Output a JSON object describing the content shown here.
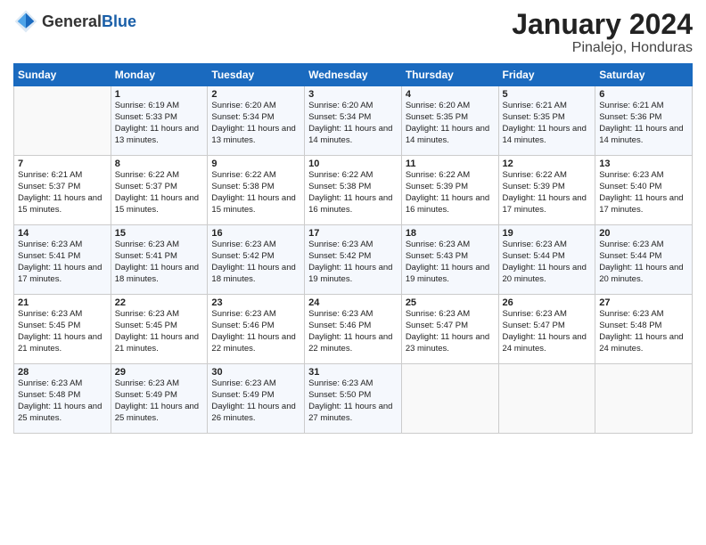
{
  "logo": {
    "text_general": "General",
    "text_blue": "Blue"
  },
  "title": "January 2024",
  "subtitle": "Pinalejo, Honduras",
  "days_header": [
    "Sunday",
    "Monday",
    "Tuesday",
    "Wednesday",
    "Thursday",
    "Friday",
    "Saturday"
  ],
  "weeks": [
    [
      {
        "day": "",
        "sunrise": "",
        "sunset": "",
        "daylight": ""
      },
      {
        "day": "1",
        "sunrise": "Sunrise: 6:19 AM",
        "sunset": "Sunset: 5:33 PM",
        "daylight": "Daylight: 11 hours and 13 minutes."
      },
      {
        "day": "2",
        "sunrise": "Sunrise: 6:20 AM",
        "sunset": "Sunset: 5:34 PM",
        "daylight": "Daylight: 11 hours and 13 minutes."
      },
      {
        "day": "3",
        "sunrise": "Sunrise: 6:20 AM",
        "sunset": "Sunset: 5:34 PM",
        "daylight": "Daylight: 11 hours and 14 minutes."
      },
      {
        "day": "4",
        "sunrise": "Sunrise: 6:20 AM",
        "sunset": "Sunset: 5:35 PM",
        "daylight": "Daylight: 11 hours and 14 minutes."
      },
      {
        "day": "5",
        "sunrise": "Sunrise: 6:21 AM",
        "sunset": "Sunset: 5:35 PM",
        "daylight": "Daylight: 11 hours and 14 minutes."
      },
      {
        "day": "6",
        "sunrise": "Sunrise: 6:21 AM",
        "sunset": "Sunset: 5:36 PM",
        "daylight": "Daylight: 11 hours and 14 minutes."
      }
    ],
    [
      {
        "day": "7",
        "sunrise": "Sunrise: 6:21 AM",
        "sunset": "Sunset: 5:37 PM",
        "daylight": "Daylight: 11 hours and 15 minutes."
      },
      {
        "day": "8",
        "sunrise": "Sunrise: 6:22 AM",
        "sunset": "Sunset: 5:37 PM",
        "daylight": "Daylight: 11 hours and 15 minutes."
      },
      {
        "day": "9",
        "sunrise": "Sunrise: 6:22 AM",
        "sunset": "Sunset: 5:38 PM",
        "daylight": "Daylight: 11 hours and 15 minutes."
      },
      {
        "day": "10",
        "sunrise": "Sunrise: 6:22 AM",
        "sunset": "Sunset: 5:38 PM",
        "daylight": "Daylight: 11 hours and 16 minutes."
      },
      {
        "day": "11",
        "sunrise": "Sunrise: 6:22 AM",
        "sunset": "Sunset: 5:39 PM",
        "daylight": "Daylight: 11 hours and 16 minutes."
      },
      {
        "day": "12",
        "sunrise": "Sunrise: 6:22 AM",
        "sunset": "Sunset: 5:39 PM",
        "daylight": "Daylight: 11 hours and 17 minutes."
      },
      {
        "day": "13",
        "sunrise": "Sunrise: 6:23 AM",
        "sunset": "Sunset: 5:40 PM",
        "daylight": "Daylight: 11 hours and 17 minutes."
      }
    ],
    [
      {
        "day": "14",
        "sunrise": "Sunrise: 6:23 AM",
        "sunset": "Sunset: 5:41 PM",
        "daylight": "Daylight: 11 hours and 17 minutes."
      },
      {
        "day": "15",
        "sunrise": "Sunrise: 6:23 AM",
        "sunset": "Sunset: 5:41 PM",
        "daylight": "Daylight: 11 hours and 18 minutes."
      },
      {
        "day": "16",
        "sunrise": "Sunrise: 6:23 AM",
        "sunset": "Sunset: 5:42 PM",
        "daylight": "Daylight: 11 hours and 18 minutes."
      },
      {
        "day": "17",
        "sunrise": "Sunrise: 6:23 AM",
        "sunset": "Sunset: 5:42 PM",
        "daylight": "Daylight: 11 hours and 19 minutes."
      },
      {
        "day": "18",
        "sunrise": "Sunrise: 6:23 AM",
        "sunset": "Sunset: 5:43 PM",
        "daylight": "Daylight: 11 hours and 19 minutes."
      },
      {
        "day": "19",
        "sunrise": "Sunrise: 6:23 AM",
        "sunset": "Sunset: 5:44 PM",
        "daylight": "Daylight: 11 hours and 20 minutes."
      },
      {
        "day": "20",
        "sunrise": "Sunrise: 6:23 AM",
        "sunset": "Sunset: 5:44 PM",
        "daylight": "Daylight: 11 hours and 20 minutes."
      }
    ],
    [
      {
        "day": "21",
        "sunrise": "Sunrise: 6:23 AM",
        "sunset": "Sunset: 5:45 PM",
        "daylight": "Daylight: 11 hours and 21 minutes."
      },
      {
        "day": "22",
        "sunrise": "Sunrise: 6:23 AM",
        "sunset": "Sunset: 5:45 PM",
        "daylight": "Daylight: 11 hours and 21 minutes."
      },
      {
        "day": "23",
        "sunrise": "Sunrise: 6:23 AM",
        "sunset": "Sunset: 5:46 PM",
        "daylight": "Daylight: 11 hours and 22 minutes."
      },
      {
        "day": "24",
        "sunrise": "Sunrise: 6:23 AM",
        "sunset": "Sunset: 5:46 PM",
        "daylight": "Daylight: 11 hours and 22 minutes."
      },
      {
        "day": "25",
        "sunrise": "Sunrise: 6:23 AM",
        "sunset": "Sunset: 5:47 PM",
        "daylight": "Daylight: 11 hours and 23 minutes."
      },
      {
        "day": "26",
        "sunrise": "Sunrise: 6:23 AM",
        "sunset": "Sunset: 5:47 PM",
        "daylight": "Daylight: 11 hours and 24 minutes."
      },
      {
        "day": "27",
        "sunrise": "Sunrise: 6:23 AM",
        "sunset": "Sunset: 5:48 PM",
        "daylight": "Daylight: 11 hours and 24 minutes."
      }
    ],
    [
      {
        "day": "28",
        "sunrise": "Sunrise: 6:23 AM",
        "sunset": "Sunset: 5:48 PM",
        "daylight": "Daylight: 11 hours and 25 minutes."
      },
      {
        "day": "29",
        "sunrise": "Sunrise: 6:23 AM",
        "sunset": "Sunset: 5:49 PM",
        "daylight": "Daylight: 11 hours and 25 minutes."
      },
      {
        "day": "30",
        "sunrise": "Sunrise: 6:23 AM",
        "sunset": "Sunset: 5:49 PM",
        "daylight": "Daylight: 11 hours and 26 minutes."
      },
      {
        "day": "31",
        "sunrise": "Sunrise: 6:23 AM",
        "sunset": "Sunset: 5:50 PM",
        "daylight": "Daylight: 11 hours and 27 minutes."
      },
      {
        "day": "",
        "sunrise": "",
        "sunset": "",
        "daylight": ""
      },
      {
        "day": "",
        "sunrise": "",
        "sunset": "",
        "daylight": ""
      },
      {
        "day": "",
        "sunrise": "",
        "sunset": "",
        "daylight": ""
      }
    ]
  ]
}
